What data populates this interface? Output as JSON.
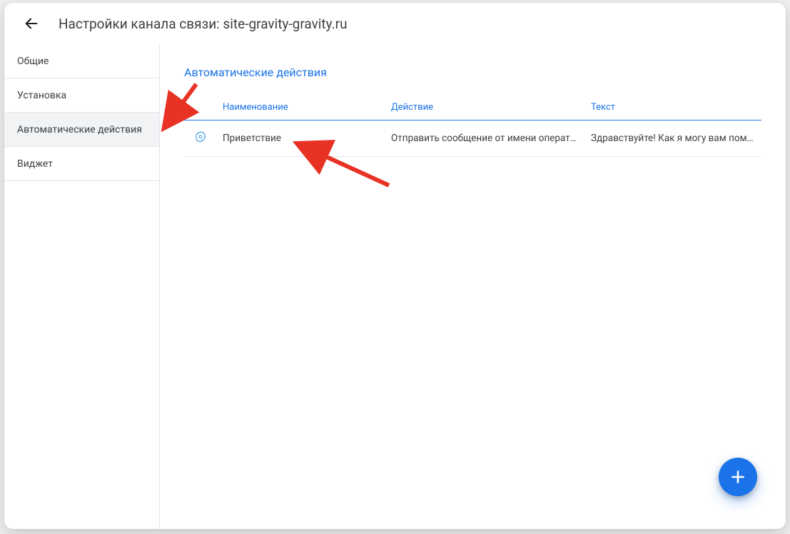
{
  "header": {
    "title": "Настройки канала связи: site-gravity-gravity.ru"
  },
  "sidebar": {
    "items": [
      {
        "label": "Общие",
        "active": false
      },
      {
        "label": "Установка",
        "active": false
      },
      {
        "label": "Автоматические действия",
        "active": true
      },
      {
        "label": "Виджет",
        "active": false
      }
    ]
  },
  "main": {
    "section_title": "Автоматические действия",
    "columns": {
      "name": "Наименование",
      "action": "Действие",
      "text": "Текст"
    },
    "rows": [
      {
        "name": "Приветствие",
        "action": "Отправить сообщение от имени оператора",
        "text": "Здравствуйте! Как я могу вам помо…"
      }
    ]
  },
  "colors": {
    "accent": "#1a73e8",
    "arrow": "#e83224"
  }
}
